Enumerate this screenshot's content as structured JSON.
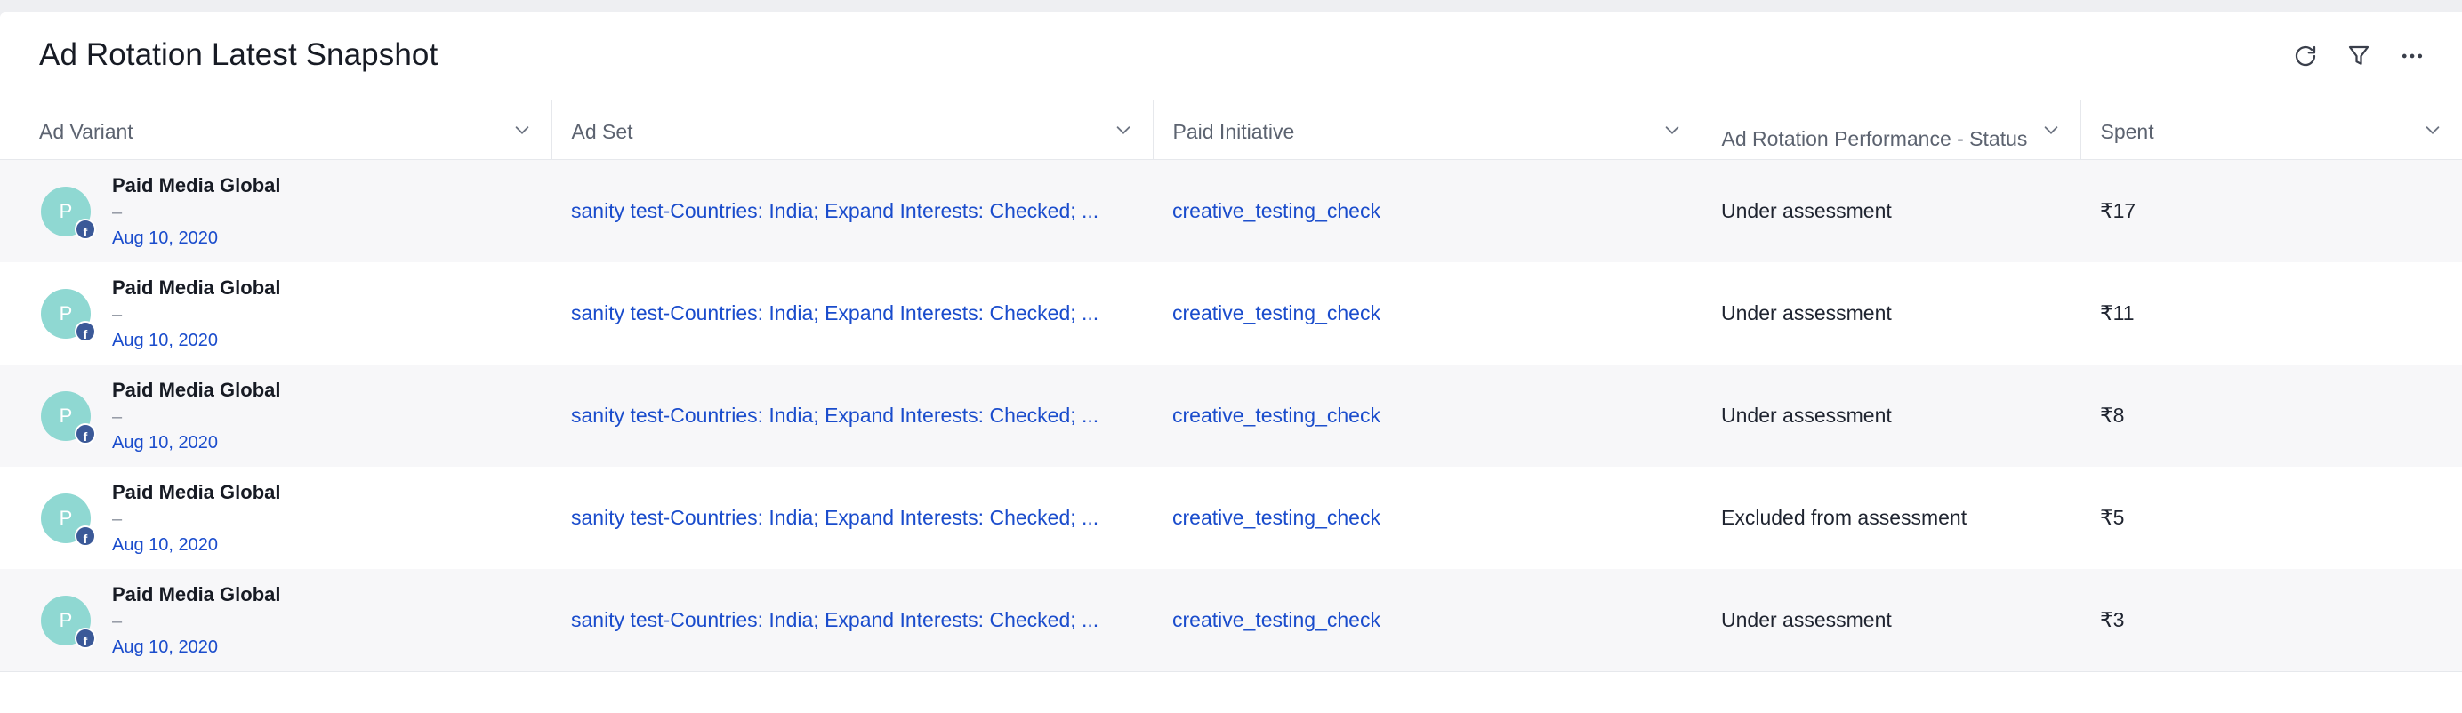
{
  "panel": {
    "title": "Ad Rotation Latest Snapshot",
    "actions": [
      {
        "name": "refresh-icon"
      },
      {
        "name": "filter-icon"
      },
      {
        "name": "more-options-icon"
      }
    ]
  },
  "table": {
    "columns": [
      {
        "label": "Ad Variant"
      },
      {
        "label": "Ad Set"
      },
      {
        "label": "Paid Initiative"
      },
      {
        "label": "Ad Rotation Performance - Status"
      },
      {
        "label": "Spent"
      }
    ],
    "rows": [
      {
        "avatar_initial": "P",
        "platform_badge": "f",
        "variant_name": "Paid Media Global",
        "variant_sub": "–",
        "variant_date": "Aug 10, 2020",
        "ad_set": "sanity test-Countries: India; Expand Interests: Checked; ...",
        "paid_initiative": "creative_testing_check",
        "status": "Under assessment",
        "spent": "₹17"
      },
      {
        "avatar_initial": "P",
        "platform_badge": "f",
        "variant_name": "Paid Media Global",
        "variant_sub": "–",
        "variant_date": "Aug 10, 2020",
        "ad_set": "sanity test-Countries: India; Expand Interests: Checked; ...",
        "paid_initiative": "creative_testing_check",
        "status": "Under assessment",
        "spent": "₹11"
      },
      {
        "avatar_initial": "P",
        "platform_badge": "f",
        "variant_name": "Paid Media Global",
        "variant_sub": "–",
        "variant_date": "Aug 10, 2020",
        "ad_set": "sanity test-Countries: India; Expand Interests: Checked; ...",
        "paid_initiative": "creative_testing_check",
        "status": "Under assessment",
        "spent": "₹8"
      },
      {
        "avatar_initial": "P",
        "platform_badge": "f",
        "variant_name": "Paid Media Global",
        "variant_sub": "–",
        "variant_date": "Aug 10, 2020",
        "ad_set": "sanity test-Countries: India; Expand Interests: Checked; ...",
        "paid_initiative": "creative_testing_check",
        "status": "Excluded from assessment",
        "spent": "₹5"
      },
      {
        "avatar_initial": "P",
        "platform_badge": "f",
        "variant_name": "Paid Media Global",
        "variant_sub": "–",
        "variant_date": "Aug 10, 2020",
        "ad_set": "sanity test-Countries: India; Expand Interests: Checked; ...",
        "paid_initiative": "creative_testing_check",
        "status": "Under assessment",
        "spent": "₹3"
      }
    ]
  },
  "colors": {
    "link": "#1a4ccc",
    "avatar_bg": "#8fd8d2",
    "facebook_badge": "#3b5998",
    "row_alt_bg": "#f7f7f9"
  }
}
